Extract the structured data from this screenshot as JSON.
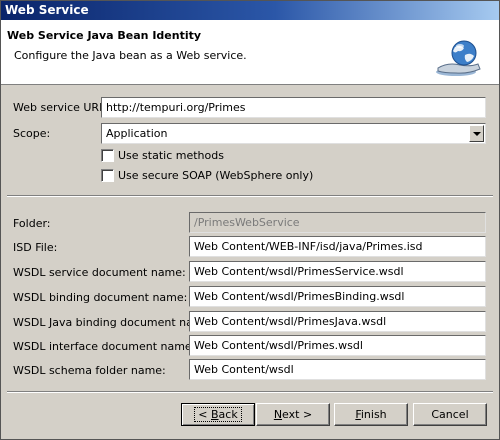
{
  "window": {
    "title": "Web Service"
  },
  "banner": {
    "title": "Web Service Java Bean Identity",
    "description": "Configure the Java bean as a Web service.",
    "icon": "web-service-globe-icon"
  },
  "form": {
    "uri_label": "Web service URI:",
    "uri_value": "http://tempuri.org/Primes",
    "scope_label": "Scope:",
    "scope_value": "Application",
    "static_methods_label": "Use static methods",
    "secure_soap_label": "Use secure SOAP (WebSphere only)",
    "folder_label": "Folder:",
    "folder_value": "/PrimesWebService",
    "isd_label": "ISD File:",
    "isd_value": "Web Content/WEB-INF/isd/java/Primes.isd",
    "wsdl_service_label": "WSDL service document name:",
    "wsdl_service_value": "Web Content/wsdl/PrimesService.wsdl",
    "wsdl_binding_label": "WSDL binding document name:",
    "wsdl_binding_value": "Web Content/wsdl/PrimesBinding.wsdl",
    "wsdl_java_binding_label": "WSDL Java binding document name:",
    "wsdl_java_binding_value": "Web Content/wsdl/PrimesJava.wsdl",
    "wsdl_interface_label": "WSDL interface document name:",
    "wsdl_interface_value": "Web Content/wsdl/Primes.wsdl",
    "wsdl_schema_label": "WSDL schema folder name:",
    "wsdl_schema_value": "Web Content/wsdl"
  },
  "buttons": {
    "back_mnemonic": "B",
    "back_rest": "ack",
    "back_prefix": "< ",
    "next_mnemonic": "N",
    "next_rest": "ext >",
    "finish_mnemonic": "F",
    "finish_rest": "inish",
    "cancel": "Cancel"
  },
  "colors": {
    "title_bar": "#0a246a",
    "dialog_face": "#d4d0c8"
  }
}
